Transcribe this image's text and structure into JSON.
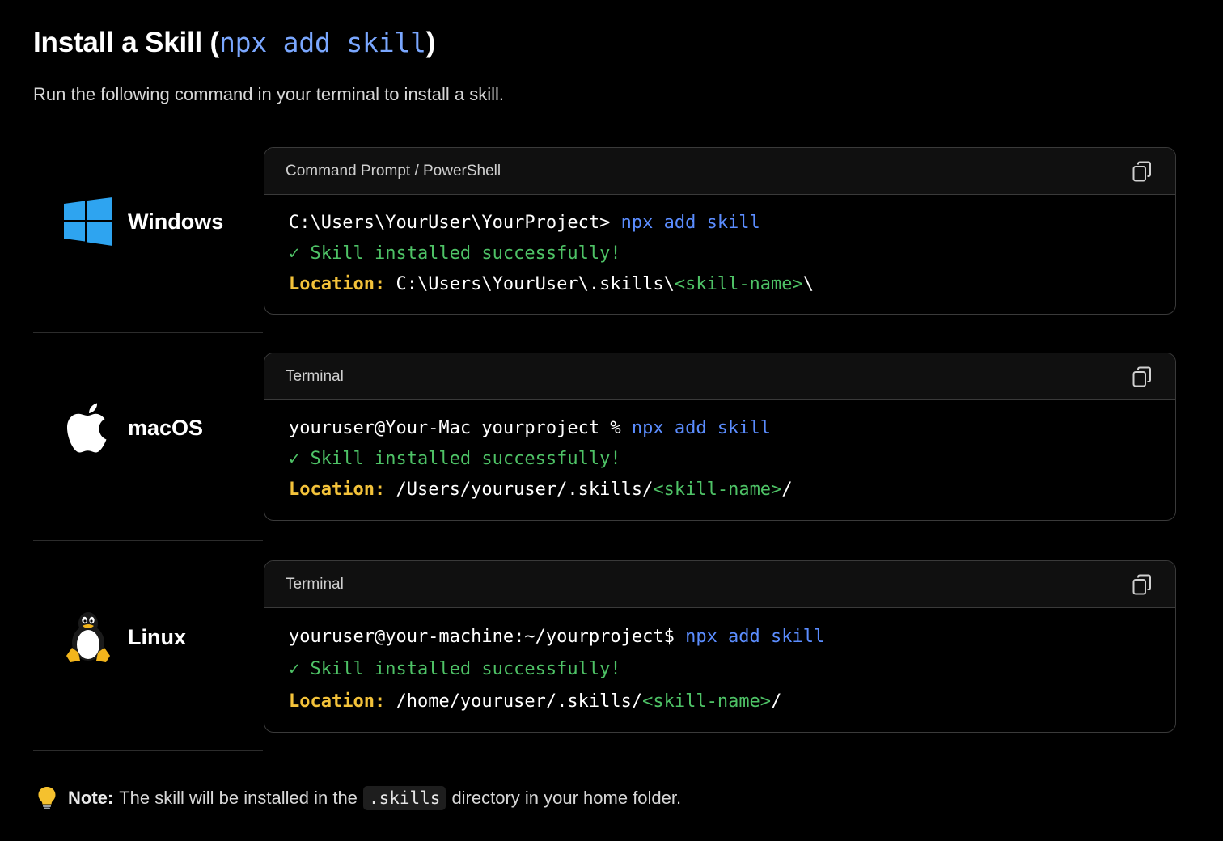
{
  "heading": {
    "title_text": "Install a Skill (",
    "title_code": "npx add skill",
    "title_close": ")",
    "subtitle": "Run the following command in your terminal to install a skill."
  },
  "platforms": [
    {
      "os": "Windows",
      "icon": "windows-logo-icon",
      "header": "Command Prompt / PowerShell",
      "prompt": "C:\\Users\\YourUser\\YourProject> ",
      "command": "npx add skill",
      "success": "✓ Skill installed successfully!",
      "location_label": "Location:",
      "location_path": " C:\\Users\\YourUser\\.skills\\",
      "placeholder": "<skill-name>",
      "location_suffix": "\\"
    },
    {
      "os": "macOS",
      "icon": "apple-logo-icon",
      "header": "Terminal",
      "prompt": "youruser@Your-Mac yourproject % ",
      "command": "npx add skill",
      "success": "✓ Skill installed successfully!",
      "location_label": "Location:",
      "location_path": " /Users/youruser/.skills/",
      "placeholder": "<skill-name>",
      "location_suffix": "/"
    },
    {
      "os": "Linux",
      "icon": "linux-tux-icon",
      "header": "Terminal",
      "prompt": "youruser@your-machine:~/yourproject$ ",
      "command": "npx add skill",
      "success": "✓ Skill installed successfully!",
      "location_label": "Location:",
      "location_path": " /home/youruser/.skills/",
      "placeholder": "<skill-name>",
      "location_suffix": "/"
    }
  ],
  "note": {
    "icon": "lightbulb-icon",
    "label": "Note:",
    "text_before": "The skill will be installed in the",
    "code": ".skills",
    "text_after": "directory in your home folder."
  },
  "colors": {
    "background": "#000000",
    "command": "#5b8dff",
    "success": "#4ec266",
    "location_label": "#f3c23a",
    "title_code": "#7aa7ff"
  }
}
